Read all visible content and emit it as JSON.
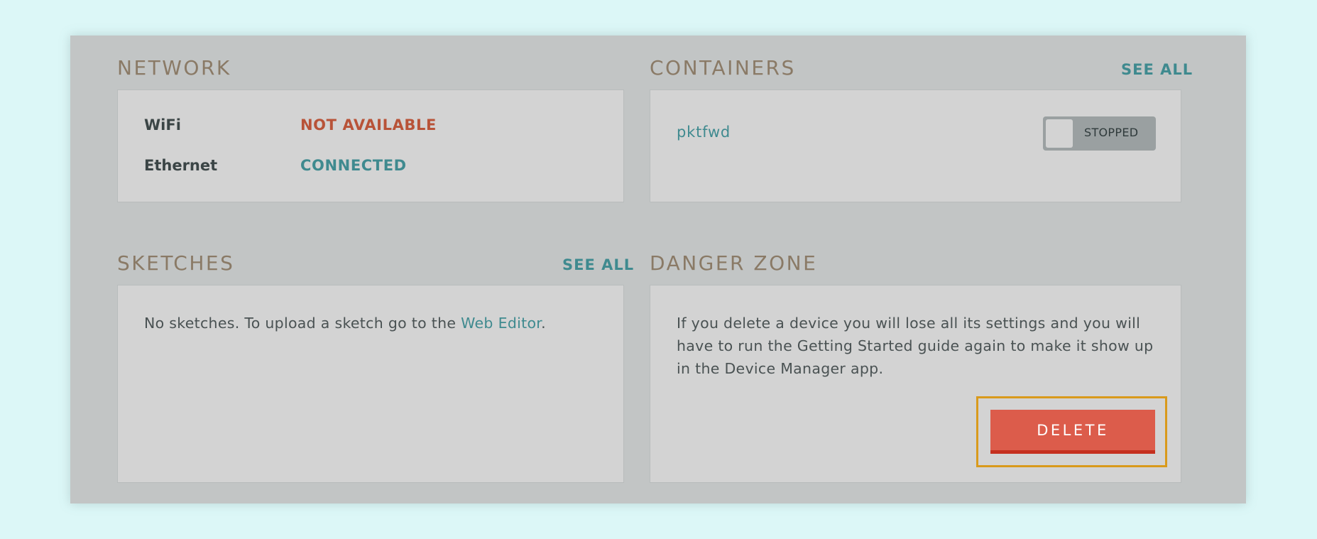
{
  "network": {
    "title": "NETWORK",
    "rows": [
      {
        "label": "WiFi",
        "value": "NOT AVAILABLE",
        "status_color": "#b85338"
      },
      {
        "label": "Ethernet",
        "value": "CONNECTED",
        "status_color": "#3f8a8f"
      }
    ]
  },
  "containers": {
    "title": "CONTAINERS",
    "see_all": "SEE ALL",
    "items": [
      {
        "name": "pktfwd",
        "state": "STOPPED",
        "toggle_on": false
      }
    ]
  },
  "sketches": {
    "title": "SKETCHES",
    "see_all": "SEE ALL",
    "empty_text_before": "No sketches. To upload a sketch go to the ",
    "link_text": "Web Editor",
    "empty_text_after": "."
  },
  "danger_zone": {
    "title": "DANGER ZONE",
    "lines": [
      "If you delete a device you will lose all its settings and you will",
      "have to run the Getting Started guide again to make it show up",
      "in the Device Manager app."
    ],
    "delete_label": "DELETE"
  },
  "colors": {
    "accent": "#3f8a8f",
    "danger": "#dc5c4b",
    "warning_text": "#b85338",
    "highlight": "#d99a1c",
    "section_title": "#8a7a66"
  }
}
